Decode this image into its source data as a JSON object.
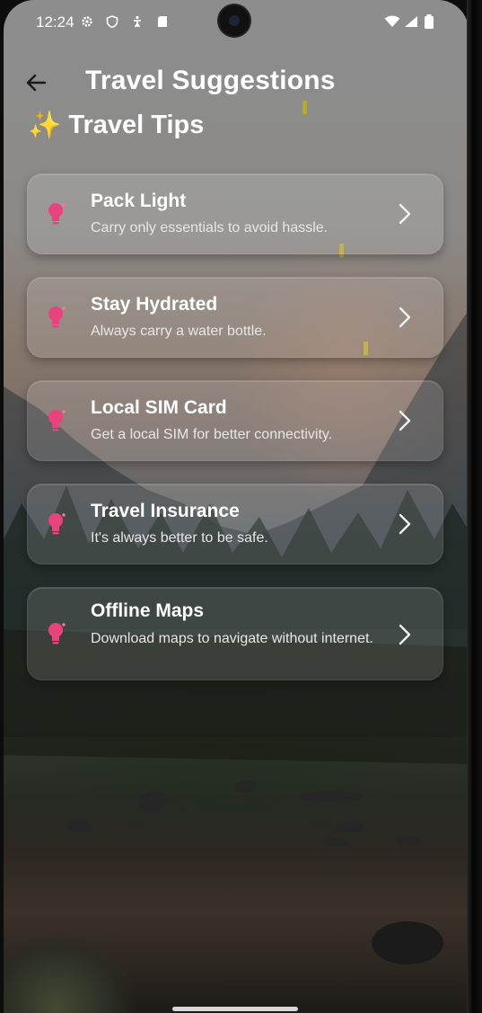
{
  "status_bar": {
    "time": "12:24"
  },
  "header": {
    "title": "Travel Suggestions"
  },
  "section": {
    "title": "Travel Tips",
    "emoji": "✨"
  },
  "tips": [
    {
      "title": "Pack Light",
      "description": "Carry only essentials to avoid hassle."
    },
    {
      "title": "Stay Hydrated",
      "description": "Always carry a water bottle."
    },
    {
      "title": "Local SIM Card",
      "description": "Get a local SIM for better connectivity."
    },
    {
      "title": "Travel Insurance",
      "description": "It's always better to be safe."
    },
    {
      "title": "Offline Maps",
      "description": "Download maps to navigate without internet."
    }
  ],
  "colors": {
    "accent": "#e8437c",
    "text": "#ffffff"
  },
  "icons": {
    "back": "arrow-left-icon",
    "tip": "lightbulb-icon",
    "chevron": "chevron-right-icon"
  }
}
